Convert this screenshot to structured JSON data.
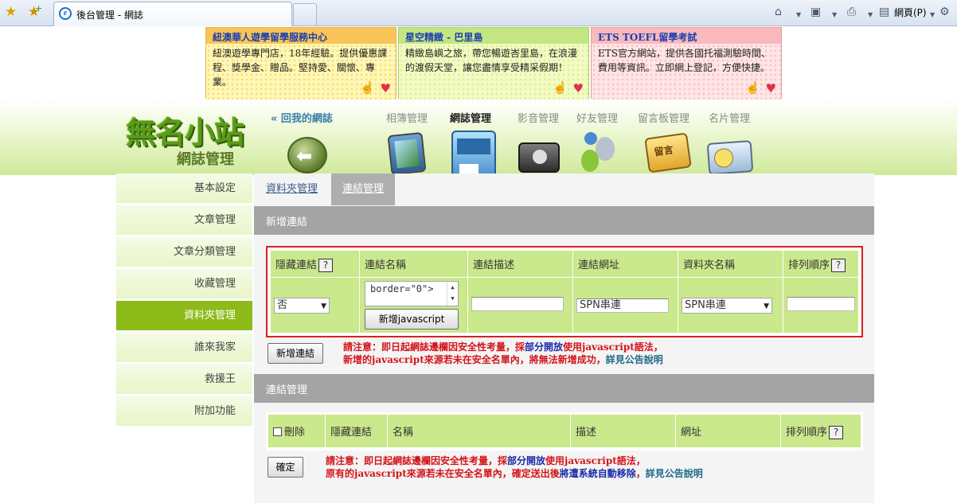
{
  "browser": {
    "tab_title": "後台管理 - 網誌",
    "page_menu_label": "網頁(P)"
  },
  "ads": [
    {
      "title": "紐澳華人遊學留學服務中心",
      "body": "紐澳遊學專門店，18年經驗。提供優惠課程、獎學金、贈品。堅持愛、關懷、專業。"
    },
    {
      "title": "星空精緻 - 巴里島",
      "body": "精緻島嶼之旅，帶您暢遊峇里島，在浪漫的渡假天堂，讓您盡情享受精采假期！"
    },
    {
      "title": "ETS TOEFL留學考試",
      "body": "ETS官方網站，提供各國托福測驗時間、費用等資訊。立即網上登記，方便快捷。"
    }
  ],
  "header": {
    "logo_main": "無名小站",
    "logo_sub": "網誌管理",
    "back_link": "« 回我的網誌",
    "nav": [
      {
        "label": "相簿管理",
        "active": false
      },
      {
        "label": "網誌管理",
        "active": true
      },
      {
        "label": "影音管理",
        "active": false
      },
      {
        "label": "好友管理",
        "active": false
      },
      {
        "label": "留言板管理",
        "active": false
      },
      {
        "label": "名片管理",
        "active": false
      }
    ],
    "board_icon_text": "留言"
  },
  "sidebar": {
    "items": [
      {
        "label": "基本設定"
      },
      {
        "label": "文章管理"
      },
      {
        "label": "文章分類管理"
      },
      {
        "label": "收藏管理"
      },
      {
        "label": "資料夾管理",
        "active": true
      },
      {
        "label": "誰來我家"
      },
      {
        "label": "救援王"
      },
      {
        "label": "附加功能"
      }
    ]
  },
  "subtabs": {
    "folder": "資料夾管理",
    "link": "連結管理"
  },
  "new_link": {
    "section_title": "新增連結",
    "columns": {
      "hidden": "隱藏連結",
      "name": "連結名稱",
      "desc": "連結描述",
      "url": "連結網址",
      "folder": "資料夾名稱",
      "order": "排列順序"
    },
    "help_symbol": "?",
    "hidden_value": "否",
    "name_value": "border=\"0\">",
    "add_js_button": "新增javascript",
    "desc_value": "",
    "url_value": "SPN串連",
    "folder_value": "SPN串連",
    "order_value": "",
    "add_button": "新增連結",
    "notice": {
      "l1_a": "請注意：即日起網誌邊欄因安全性考量，採",
      "l1_b": "部分開放",
      "l1_c": "使用javascript語法，",
      "l2_a": "新增的javascript來源若未在安全名單內，將無法新增成功，",
      "l2_b": "詳見公告說明"
    }
  },
  "manage": {
    "section_title": "連結管理",
    "columns": {
      "delete": "刪除",
      "hidden": "隱藏連結",
      "name": "名稱",
      "desc": "描述",
      "url": "網址",
      "order": "排列順序"
    },
    "confirm_button": "確定",
    "notice": {
      "l1_a": "請注意：即日起網誌邊欄因安全性考量，採",
      "l1_b": "部分開放",
      "l1_c": "使用javascript語法，",
      "l2_a": "原有的javascript來源若未在安全名單內，確定送出後",
      "l2_b": "將遭系統自動移除",
      "l2_c": "，",
      "l2_d": "詳見公告說明"
    }
  }
}
